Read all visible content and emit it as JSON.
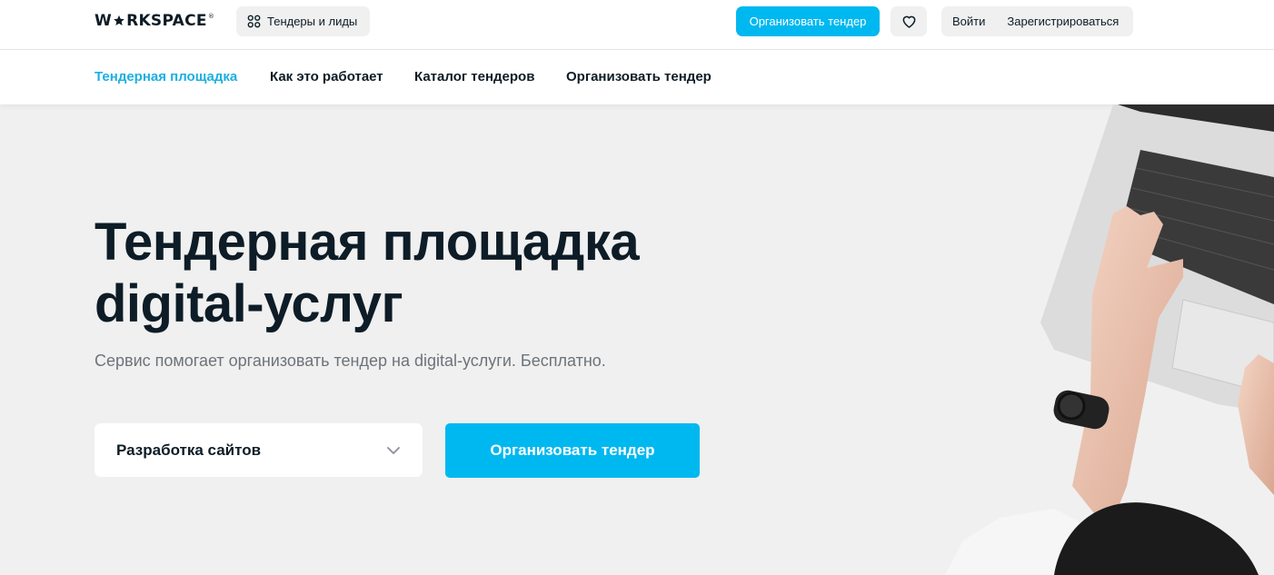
{
  "header": {
    "logo_text_pre": "W",
    "logo_text_post": "RKSPACE",
    "logo_reg": "®",
    "tenders_pill_label": "Тендеры и лиды",
    "cta_label": "Организовать тендер",
    "login_label": "Войти",
    "register_label": "Зарегистрироваться"
  },
  "nav": {
    "items": [
      {
        "label": "Тендерная площадка"
      },
      {
        "label": "Как это работает"
      },
      {
        "label": "Каталог тендеров"
      },
      {
        "label": "Организовать тендер"
      }
    ]
  },
  "hero": {
    "title_line1": "Тендерная площадка",
    "title_line2": "digital-услуг",
    "subtitle": "Сервис помогает организовать тендер на digital-услуги. Бесплатно.",
    "select_value": "Разработка сайтов",
    "cta_label": "Организовать тендер"
  },
  "colors": {
    "accent": "#00b8f0",
    "nav_active": "#1cb0e0",
    "text": "#0d1c26",
    "muted": "#6d737a",
    "background": "#f0f0f0"
  },
  "icons": {
    "tenders": "grid-icon",
    "favorites": "heart-icon",
    "select": "chevron-down-icon"
  }
}
